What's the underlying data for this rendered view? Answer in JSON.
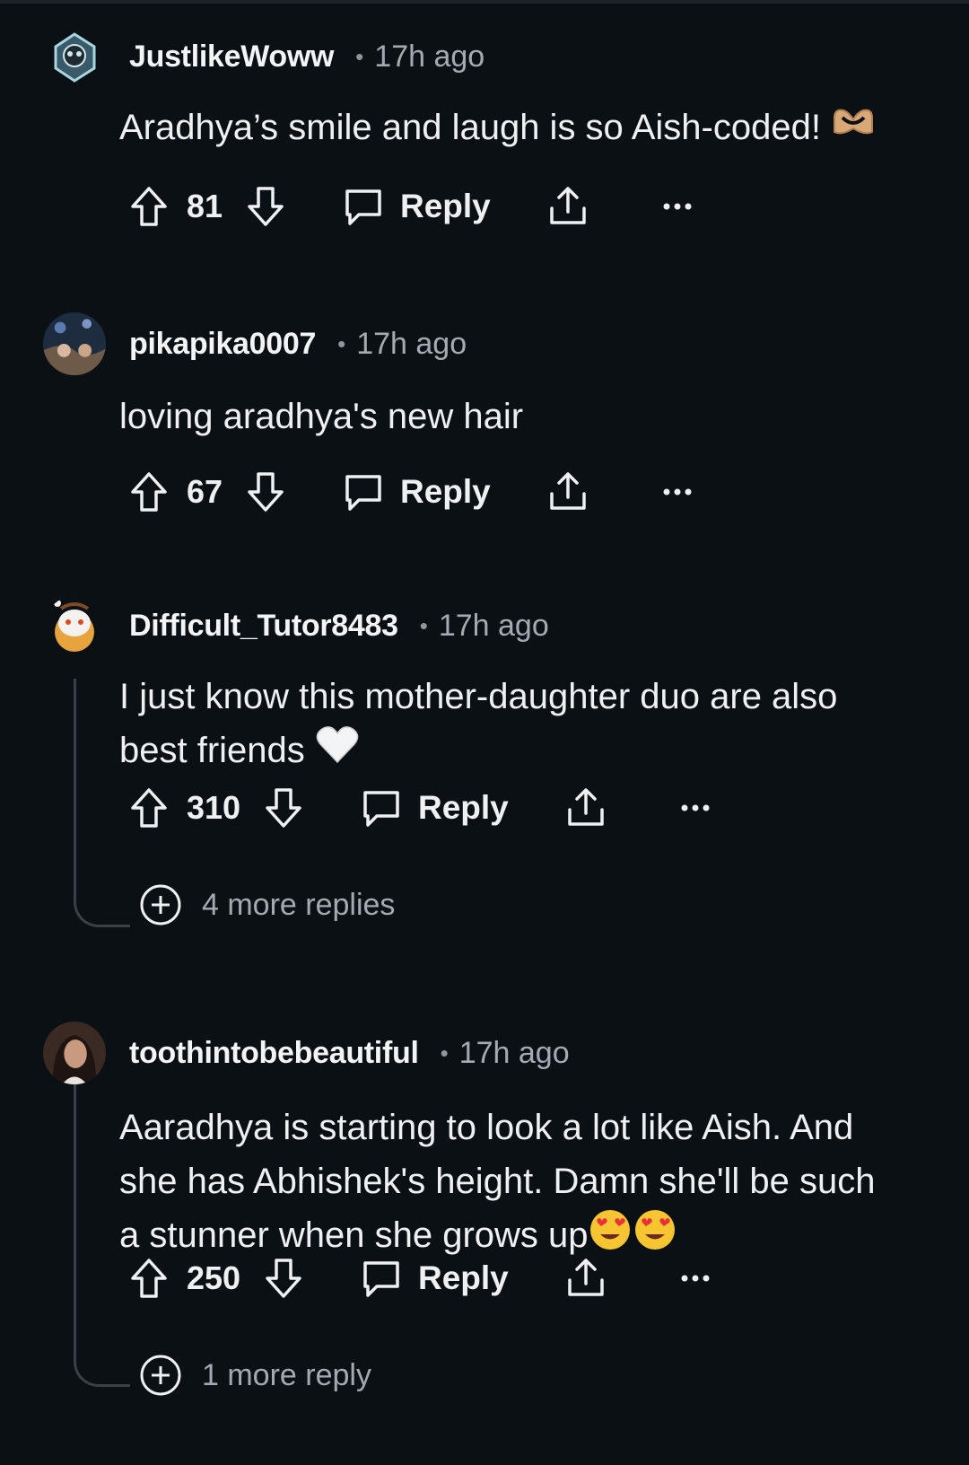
{
  "comments": [
    {
      "username": "JustlikeWoww",
      "time": "17h ago",
      "text": "Aradhya’s smile and laugh is so Aish-coded!",
      "emoji_icon": "heart-hands-emoji",
      "votes": "81",
      "reply_label": "Reply"
    },
    {
      "username": "pikapika0007",
      "time": "17h ago",
      "text": "loving aradhya's new hair",
      "votes": "67",
      "reply_label": "Reply"
    },
    {
      "username": "Difficult_Tutor8483",
      "time": "17h ago",
      "text_line1": "I just know this mother-daughter duo are also",
      "text_line2": "best friends",
      "emoji_icon": "white-heart-emoji",
      "votes": "310",
      "reply_label": "Reply",
      "more_replies": "4 more replies"
    },
    {
      "username": "toothintobebeautiful",
      "time": "17h ago",
      "text_line1": "Aaradhya is starting to look a lot like Aish. And",
      "text_line2": "she has Abhishek's height. Damn she'll be such",
      "text_line3": "a stunner when she grows up",
      "emoji_icon": "heart-eyes-emoji",
      "votes": "250",
      "reply_label": "Reply",
      "more_replies": "1 more reply"
    }
  ],
  "separator": "•",
  "colors": {
    "background": "#0b1014",
    "text": "#eef0f1",
    "muted": "#a4abb0",
    "thread_line": "#3a4045"
  }
}
